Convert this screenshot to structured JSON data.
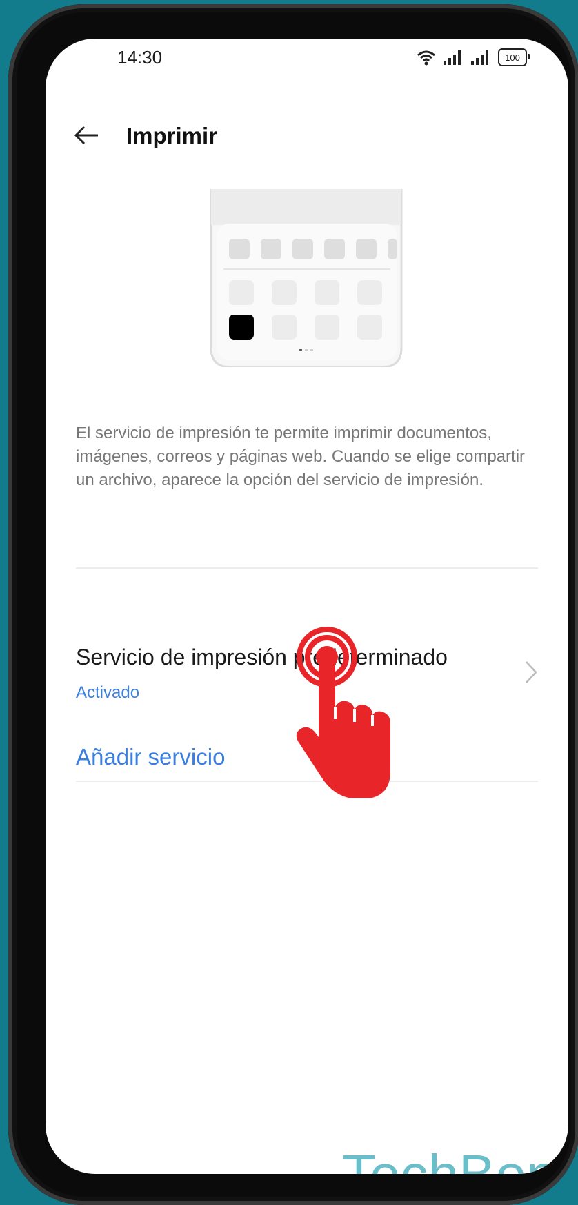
{
  "status_bar": {
    "time": "14:30",
    "battery": "100"
  },
  "header": {
    "title": "Imprimir"
  },
  "description": "El servicio de impresión te permite imprimir documentos, imágenes, correos y páginas web. Cuando se elige compartir un archivo, aparece la opción del servicio de impresión.",
  "service_row": {
    "title": "Servicio de impresión predeterminado",
    "status": "Activado"
  },
  "add_service": {
    "label": "Añadir servicio"
  },
  "watermark": "TechBone",
  "colors": {
    "accent": "#3a7fe0",
    "background": "#127b8c",
    "tap_indicator": "#e8262a"
  },
  "icons": [
    "back-arrow-icon",
    "wifi-icon",
    "signal-icon",
    "battery-icon",
    "chevron-right-icon",
    "tap-hand-icon"
  ]
}
